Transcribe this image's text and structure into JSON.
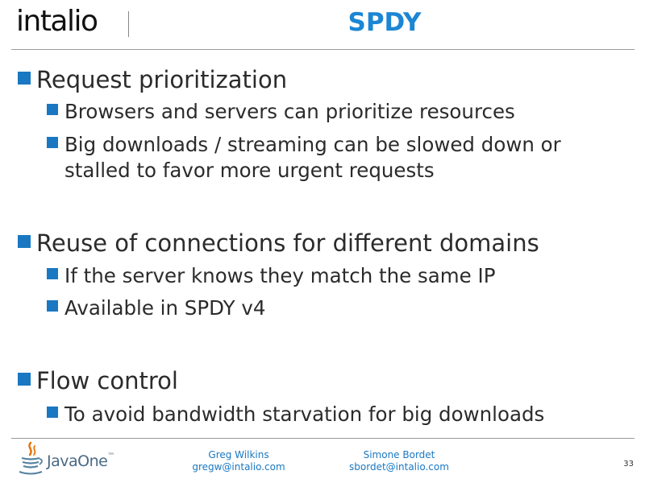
{
  "header": {
    "logo_text": "intalio",
    "title": "SPDY"
  },
  "bullets": [
    {
      "level": 1,
      "text": "Request prioritization"
    },
    {
      "level": 2,
      "text": "Browsers and servers can prioritize resources"
    },
    {
      "level": 2,
      "lines": [
        "Big downloads / streaming can be slowed down or",
        "stalled to favor more urgent requests"
      ]
    },
    {
      "level": 1,
      "text": "Reuse of connections for different domains"
    },
    {
      "level": 2,
      "text": "If the server knows they match the same IP"
    },
    {
      "level": 2,
      "text": "Available in SPDY v4"
    },
    {
      "level": 1,
      "text": "Flow control"
    },
    {
      "level": 2,
      "text": "To avoid bandwidth starvation for big downloads"
    }
  ],
  "footer": {
    "logo_text": "JavaOne",
    "trademark": "™",
    "author1": {
      "name": "Greg Wilkins",
      "email": "gregw@intalio.com"
    },
    "author2": {
      "name": "Simone Bordet",
      "email": "sbordet@intalio.com"
    },
    "page_number": "33"
  },
  "colors": {
    "accent": "#1c86d4",
    "bullet": "#1a78c2",
    "text": "#2b2b2b"
  }
}
